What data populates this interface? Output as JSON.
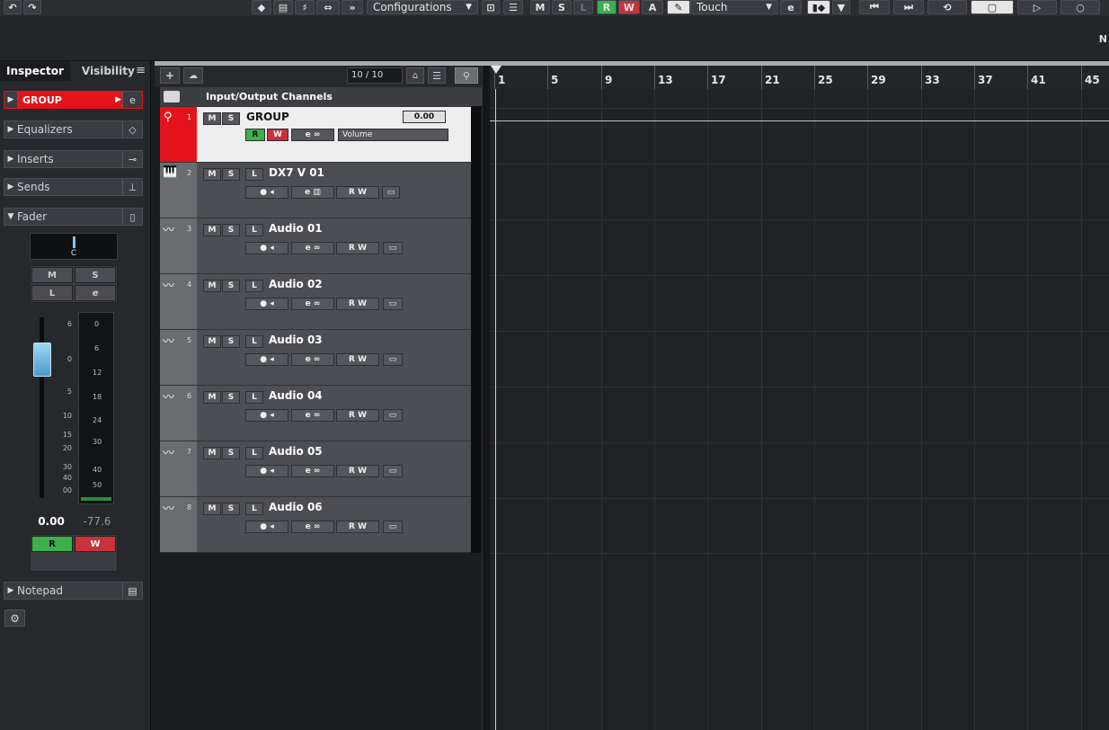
{
  "toolbar": {
    "configurations": "Configurations",
    "mode_buttons": [
      "M",
      "S",
      "L",
      "R",
      "W",
      "A"
    ],
    "automation_mode": "Touch",
    "edge_text": "N"
  },
  "inspector": {
    "tabs": [
      "Inspector",
      "Visibility"
    ],
    "track_name": "GROUP",
    "sections": {
      "equalizers": "Equalizers",
      "inserts": "Inserts",
      "sends": "Sends",
      "fader": "Fader",
      "notepad": "Notepad"
    },
    "fader": {
      "pan": "C",
      "buttons": [
        "M",
        "S",
        "L",
        "e"
      ],
      "scale_left": [
        "6",
        "0",
        "5",
        "10",
        "15",
        "20",
        "30",
        "40",
        "00"
      ],
      "scale_right": [
        "0",
        "6",
        "12",
        "18",
        "24",
        "30",
        "40",
        "50"
      ],
      "value": "0.00",
      "peak": "-77.6",
      "read": "R",
      "write": "W"
    }
  },
  "project": {
    "track_count": "10 / 10",
    "folder_label": "Input/Output Channels"
  },
  "tracks": [
    {
      "num": "1",
      "name": "GROUP",
      "volume_label": "Volume",
      "volume_value": "0.00"
    },
    {
      "num": "2",
      "name": "DX7 V 01"
    },
    {
      "num": "3",
      "name": "Audio 01"
    },
    {
      "num": "4",
      "name": "Audio 02"
    },
    {
      "num": "5",
      "name": "Audio 03"
    },
    {
      "num": "6",
      "name": "Audio 04"
    },
    {
      "num": "7",
      "name": "Audio 05"
    },
    {
      "num": "8",
      "name": "Audio 06"
    }
  ],
  "track_buttons": {
    "m": "M",
    "s": "S",
    "l": "L",
    "r": "R",
    "w": "W"
  },
  "ruler": [
    "1",
    "5",
    "9",
    "13",
    "17",
    "21",
    "25",
    "29",
    "33",
    "37",
    "41",
    "45"
  ]
}
